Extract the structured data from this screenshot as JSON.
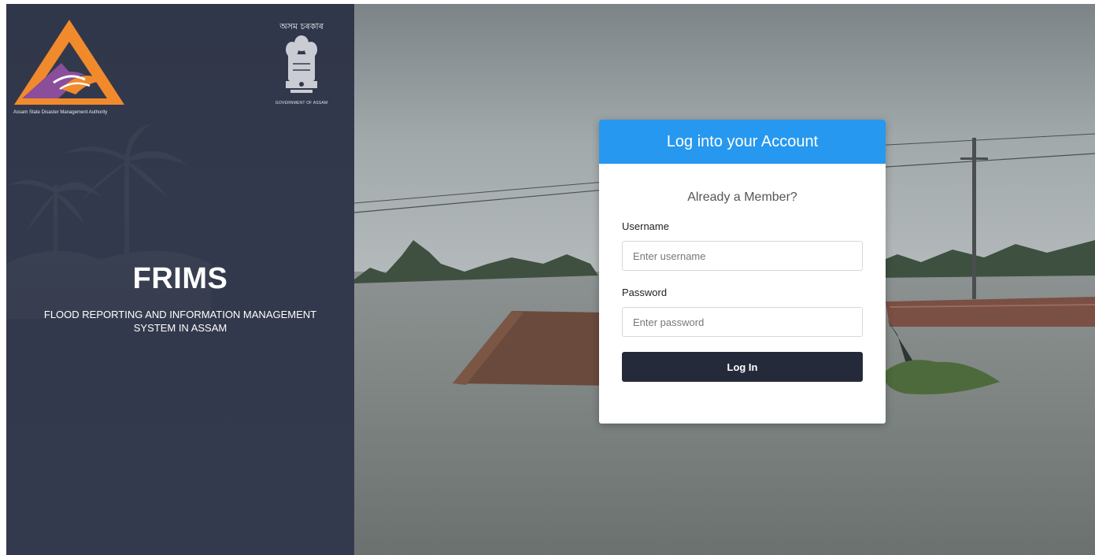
{
  "branding": {
    "asdma_caption": "Assam State Disaster Management Authority",
    "gov_title": "অসম চৰকাৰ",
    "gov_caption": "GOVERNMENT OF ASSAM",
    "app_title": "FRIMS",
    "app_subtitle": "FLOOD REPORTING AND INFORMATION MANAGEMENT SYSTEM IN ASSAM"
  },
  "login": {
    "header": "Log into your Account",
    "subheading": "Already a Member?",
    "username_label": "Username",
    "username_placeholder": "Enter username",
    "password_label": "Password",
    "password_placeholder": "Enter password",
    "submit_label": "Log In"
  },
  "colors": {
    "panel_bg": "#33394c",
    "header_blue": "#2798ef",
    "button_dark": "#252a3a",
    "logo_orange": "#f08a2c",
    "logo_purple": "#8a4e9a"
  },
  "icons": {
    "asdma": "asdma-logo",
    "emblem": "state-emblem-icon"
  }
}
